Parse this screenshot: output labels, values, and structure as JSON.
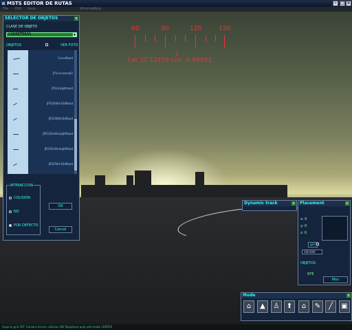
{
  "window": {
    "title": "MSTS EDITOR DE RUTAS",
    "min_icon": "minimize-icon",
    "max_icon": "maximize-icon",
    "close_icon": "close-icon"
  },
  "menubar": {
    "items": [
      "File",
      "Edit",
      "View",
      "Windows",
      "Help"
    ]
  },
  "compass": {
    "headings": [
      "60",
      "90",
      "120",
      "150"
    ],
    "coords": "Lat 37.12459  Lon -6.69852",
    "color": "#e03030"
  },
  "selector": {
    "title": "SELECTOR DE OBJETOS",
    "class_label": "CLASE DE OBJETO",
    "class_value": "CARRETERAS",
    "objects_label": "OBJETOS",
    "see_photo_label": "VER FOTO",
    "objects": [
      "CurveRoad",
      "JP1curveroad2",
      "JP1straightroad",
      "JP21000m10dRoad",
      "JP21000m5dRoad",
      "JP2150mStraightRoad",
      "JP210mStraightRoad",
      "JP2250m10dRoad"
    ],
    "interaction_label": "INTERACCION",
    "options": [
      "COLISION",
      "NO",
      "POR DEFECTO"
    ],
    "ok_label": "OK",
    "cancel_label": "Cancel"
  },
  "dynamic_track": {
    "title": "Dynamic track"
  },
  "placement": {
    "title": "Placement",
    "x_label": "x: 0",
    "y_label": "y: 0",
    "z_label": "z: 0",
    "grid_label": "grid",
    "grid_value": "100.000",
    "objects_label": "OBJETOS",
    "objects_count": "975",
    "move_label": "Mov"
  },
  "mode": {
    "title": "Mode",
    "buttons": [
      "house-icon",
      "signal-icon",
      "lamp-icon",
      "marker-icon",
      "house-outline-icon",
      "pen-icon",
      "road-icon",
      "car-icon"
    ]
  },
  "status": {
    "text": "Snap to grid OFF Camera terrain collision ON  Telephone pole edit mode CENTER"
  },
  "colors": {
    "panel_bg": "#14243c",
    "title_text": "#33eedd",
    "accent_green": "#2c7b2c"
  }
}
